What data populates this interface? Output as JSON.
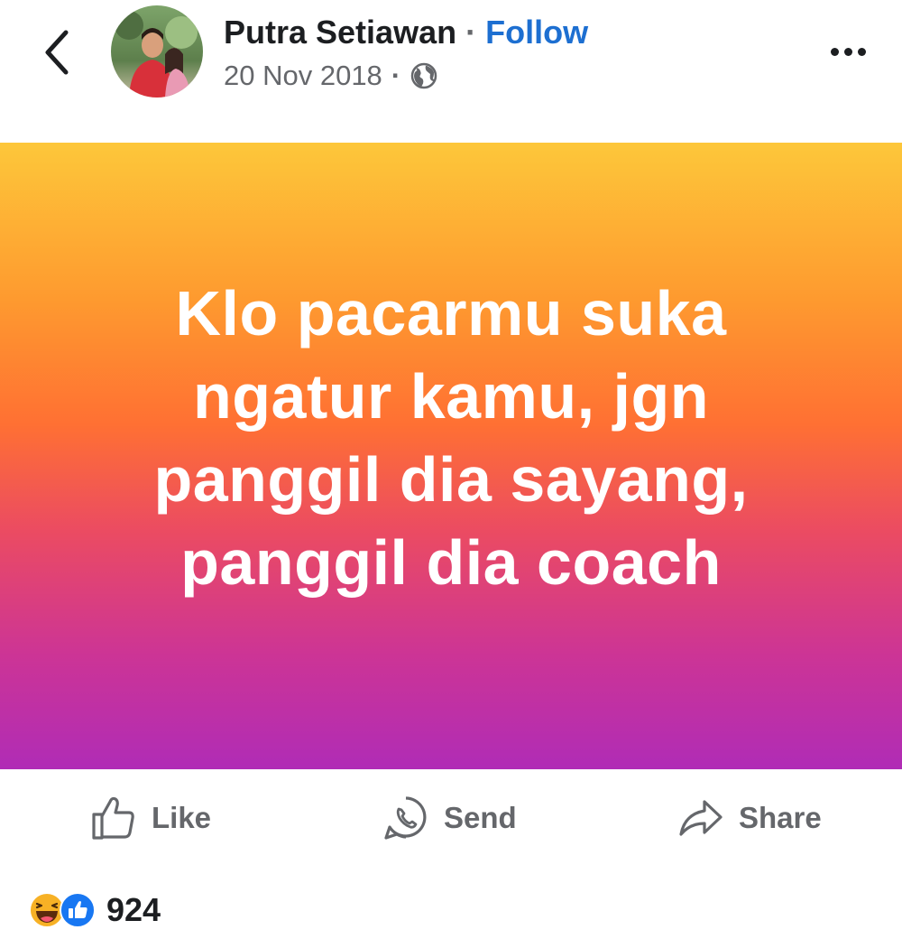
{
  "header": {
    "author_name": "Putra Setiawan",
    "separator": "·",
    "follow_label": "Follow",
    "date": "20 Nov 2018",
    "meta_separator": "·",
    "privacy_icon": "globe-icon",
    "back_icon": "chevron-left-icon",
    "more_icon": "more-horizontal-icon"
  },
  "post": {
    "text": "Klo pacarmu suka ngatur kamu, jgn panggil dia sayang, panggil dia coach",
    "background_colors": [
      "#fdc73a",
      "#fe9a2f",
      "#ff7033",
      "#eb4b62",
      "#cc3496",
      "#b02cb6"
    ]
  },
  "actions": {
    "like_label": "Like",
    "send_label": "Send",
    "share_label": "Share"
  },
  "reactions": {
    "icons": [
      "haha-icon",
      "like-reaction-icon"
    ],
    "count": "924"
  },
  "colors": {
    "follow": "#1d6fd1",
    "secondary_text": "#65676b",
    "primary_text": "#1c1e21"
  }
}
